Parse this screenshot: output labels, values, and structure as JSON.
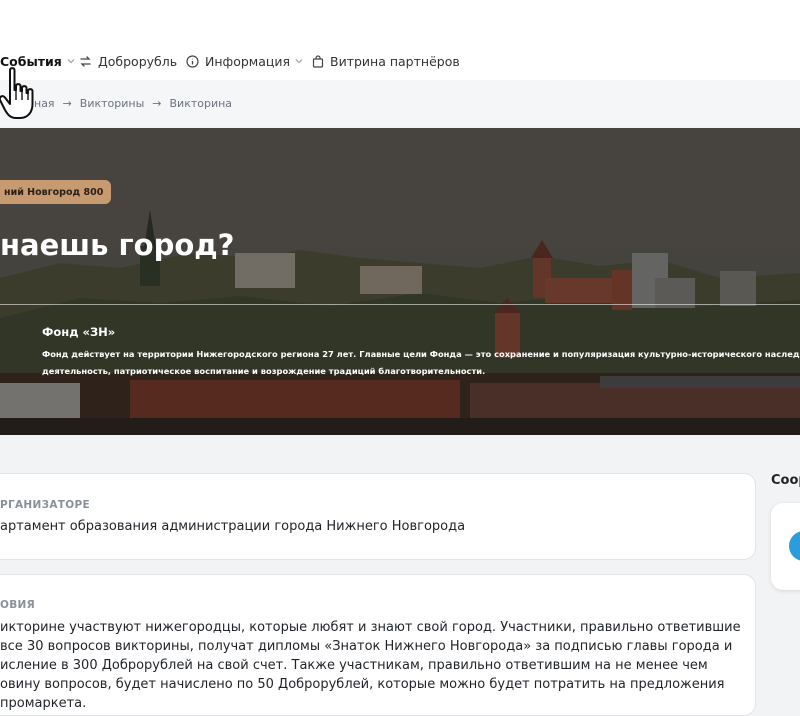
{
  "nav": {
    "items": [
      {
        "label": "События",
        "icon": "none",
        "has_dropdown": true
      },
      {
        "label": "Доброрубль",
        "icon": "exchange-icon",
        "has_dropdown": false
      },
      {
        "label": "Информация",
        "icon": "info-icon",
        "has_dropdown": true
      },
      {
        "label": "Витрина партнёров",
        "icon": "shopping-bag-icon",
        "has_dropdown": false
      }
    ]
  },
  "breadcrumb": {
    "items": [
      "ная",
      "Викторины",
      "Викторина"
    ],
    "separator": "→"
  },
  "hero": {
    "badge": "ний Новгород 800",
    "title": "наешь город?",
    "org_name": "Фонд «ЗН»",
    "description_lines": [
      "Фонд действует на территории Нижегородского региона 27 лет. Главные цели Фонда — это сохранение и популяризация культурно-исторического наследия Нижнего Н",
      "деятельность, патриотическое воспитание и возрождение традиций благотворительности."
    ],
    "badge_color": "#c79a72"
  },
  "organizer": {
    "heading": "РГАНИЗАТОРЕ",
    "text": "артамент образования администрации города Нижнего Новгорода"
  },
  "conditions": {
    "heading": "ОВИЯ",
    "lines": [
      "икторине участвуют нижегородцы, которые любят и знают свой город. Участники, правильно ответившие",
      "все 30 вопросов викторины, получат дипломы «Знаток Нижнего Новгорода» за подписью главы города и",
      "исление в 300 Доброрублей на свой счет. Также участникам, правильно ответившим на не менее чем",
      "овину вопросов, будет начислено по 50 Доброрублей, которые можно будет потратить на предложения",
      "промаркета."
    ]
  },
  "sidebar": {
    "title": "Coop"
  },
  "colors": {
    "accent_avatar": "#2d9cdb"
  }
}
